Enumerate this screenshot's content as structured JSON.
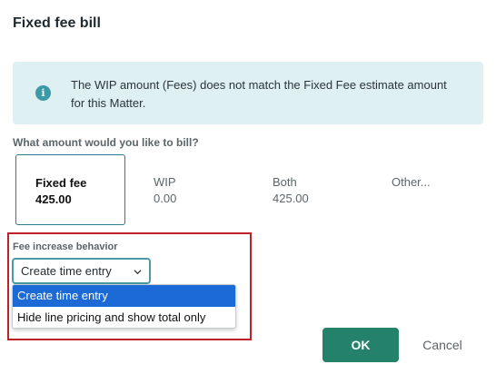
{
  "dialog": {
    "title": "Fixed fee bill"
  },
  "info": {
    "icon": "info-icon",
    "glyph": "i",
    "color": "#3c9aa7",
    "background": "#dff0f3",
    "message": "The WIP amount (Fees) does not match the Fixed Fee estimate amount for this Matter."
  },
  "bill_question": "What amount would you like to bill?",
  "bill_options": [
    {
      "label": "Fixed fee",
      "value": "425.00",
      "selected": true
    },
    {
      "label": "WIP",
      "value": "0.00",
      "selected": false
    },
    {
      "label": "Both",
      "value": "425.00",
      "selected": false
    },
    {
      "label": "Other...",
      "value": "",
      "selected": false
    }
  ],
  "fee_increase": {
    "label": "Fee increase behavior",
    "selected": "Create time entry",
    "options": [
      {
        "label": "Create time entry",
        "highlighted": true
      },
      {
        "label": "Hide line pricing and show total only",
        "highlighted": false
      }
    ]
  },
  "buttons": {
    "ok": "OK",
    "cancel": "Cancel"
  },
  "colors": {
    "accent": "#24826b",
    "select_border": "#4c9aa3",
    "dropdown_highlight": "#1c6ad6",
    "annotation_box": "#c0202a"
  }
}
